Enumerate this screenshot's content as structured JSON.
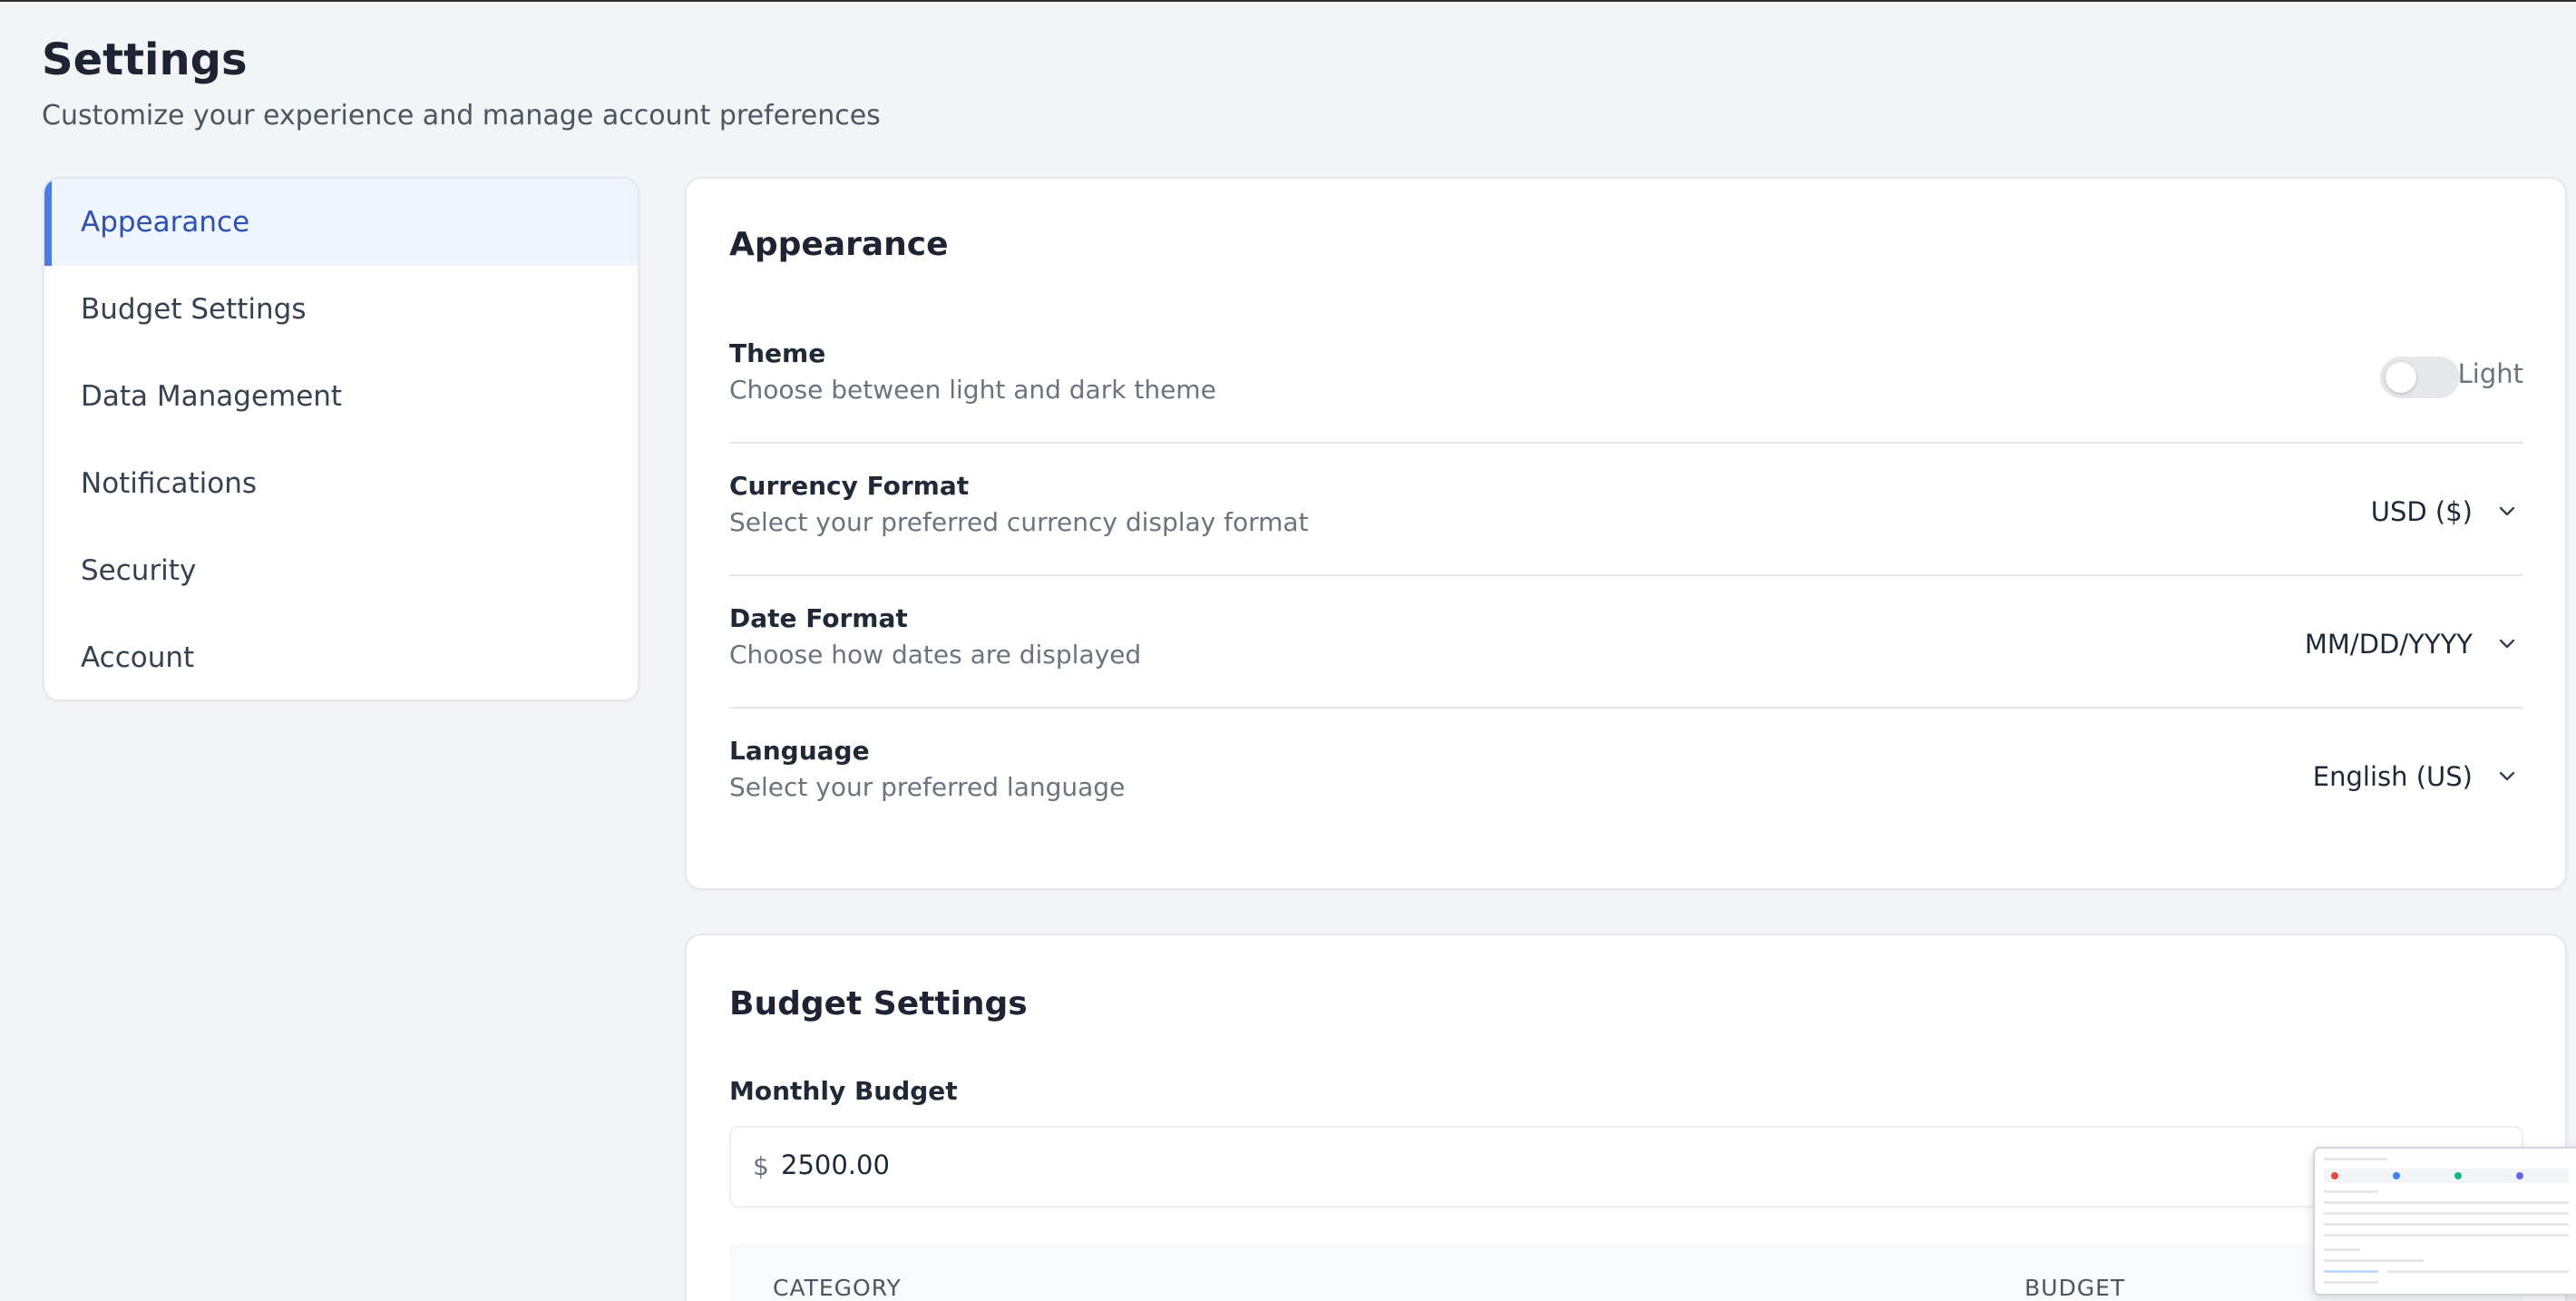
{
  "header": {
    "title": "Settings",
    "subtitle": "Customize your experience and manage account preferences"
  },
  "sidebar": {
    "items": [
      {
        "label": "Appearance",
        "active": true
      },
      {
        "label": "Budget Settings",
        "active": false
      },
      {
        "label": "Data Management",
        "active": false
      },
      {
        "label": "Notifications",
        "active": false
      },
      {
        "label": "Security",
        "active": false
      },
      {
        "label": "Account",
        "active": false
      }
    ]
  },
  "appearance": {
    "title": "Appearance",
    "theme": {
      "label": "Theme",
      "description": "Choose between light and dark theme",
      "toggle_text": "Light",
      "enabled": false
    },
    "currency": {
      "label": "Currency Format",
      "description": "Select your preferred currency display format",
      "value": "USD ($)"
    },
    "date": {
      "label": "Date Format",
      "description": "Choose how dates are displayed",
      "value": "MM/DD/YYYY"
    },
    "language": {
      "label": "Language",
      "description": "Select your preferred language",
      "value": "English (US)"
    }
  },
  "budget": {
    "title": "Budget Settings",
    "monthly_label": "Monthly Budget",
    "currency_symbol": "$",
    "monthly_value": "2500.00",
    "table": {
      "columns": [
        "CATEGORY",
        "BUDGET"
      ]
    }
  },
  "colors": {
    "accent": "#4a7cf0",
    "active_bg": "#eef5fe",
    "active_text": "#2c4fb8",
    "page_bg": "#f3f4f6"
  }
}
